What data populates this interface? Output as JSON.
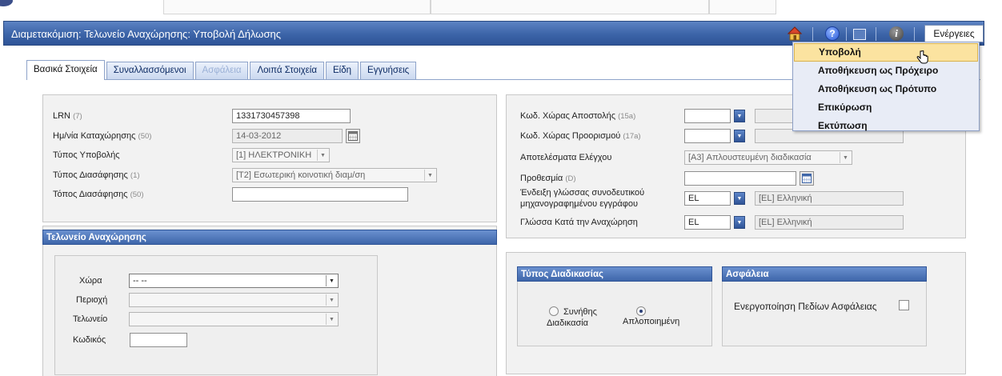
{
  "window": {
    "title": "Διαμετακόμιση: Τελωνείο Αναχώρησης: Υποβολή Δήλωσης",
    "actions_label": "Ενέργειες",
    "toolbar_icons": [
      "home-icon",
      "help-icon",
      "window-icon",
      "info-icon"
    ]
  },
  "actions_menu": {
    "items": [
      {
        "label": "Υποβολή",
        "active": true
      },
      {
        "label": "Αποθήκευση ως Πρόχειρο"
      },
      {
        "label": "Αποθήκευση ως Πρότυπο"
      },
      {
        "label": "Επικύρωση"
      },
      {
        "label": "Εκτύπωση"
      }
    ]
  },
  "tabs": [
    {
      "label": "Βασικά Στοιχεία",
      "active": true
    },
    {
      "label": "Συναλλασσόμενοι"
    },
    {
      "label": "Ασφάλεια",
      "disabled": true
    },
    {
      "label": "Λοιπά Στοιχεία"
    },
    {
      "label": "Είδη"
    },
    {
      "label": "Εγγυήσεις"
    }
  ],
  "basic": {
    "lrn": {
      "label": "LRN",
      "hint": "(7)",
      "value": "1331730457398"
    },
    "reg_date": {
      "label": "Ημ/νία Καταχώρησης",
      "hint": "(50)",
      "value": "14-03-2012"
    },
    "submission_type": {
      "label": "Τύπος Υποβολής",
      "value": "[1] ΗΛΕΚΤΡΟΝΙΚΗ"
    },
    "declaration_type": {
      "label": "Τύπος Διασάφησης",
      "hint": "(1)",
      "value": "[T2] Εσωτερική κοινοτική διαμ/ση"
    },
    "declaration_place": {
      "label": "Τόπος Διασάφησης",
      "hint": "(50)",
      "value": ""
    }
  },
  "departure_office": {
    "header": "Τελωνείο Αναχώρησης",
    "country": {
      "label": "Χώρα",
      "value": "-- --"
    },
    "region": {
      "label": "Περιοχή",
      "value": ""
    },
    "office": {
      "label": "Τελωνείο",
      "value": ""
    },
    "code": {
      "label": "Κωδικός",
      "value": ""
    }
  },
  "right": {
    "dispatch_country": {
      "label": "Κωδ. Χώρας Αποστολής",
      "hint": "(15a)",
      "value": "",
      "desc": ""
    },
    "destination_country": {
      "label": "Κωδ. Χώρας Προορισμού",
      "hint": "(17a)",
      "value": "",
      "desc": ""
    },
    "control_results": {
      "label": "Αποτελέσματα Ελέγχου",
      "value": "[A3] Απλουστευμένη διαδικασία"
    },
    "deadline": {
      "label": "Προθεσμία",
      "hint": "(D)",
      "value": ""
    },
    "doc_language": {
      "label_line1": "Ένδειξη γλώσσας συνοδευτικού",
      "label_line2": "μηχανογραφημένου εγγράφου",
      "value": "EL",
      "desc": "[EL] Ελληνική"
    },
    "departure_language": {
      "label": "Γλώσσα Κατά την Αναχώρηση",
      "value": "EL",
      "desc": "[EL] Ελληνική"
    }
  },
  "procedure": {
    "header": "Τύπος Διαδικασίας",
    "normal_line1": "Συνήθης",
    "normal_line2": "Διαδικασία",
    "simplified": "Απλοποιημένη",
    "selected": "simplified"
  },
  "security": {
    "header": "Ασφάλεια",
    "checkbox_label": "Ενεργοποίηση Πεδίων Ασφάλειας",
    "checked": false
  }
}
